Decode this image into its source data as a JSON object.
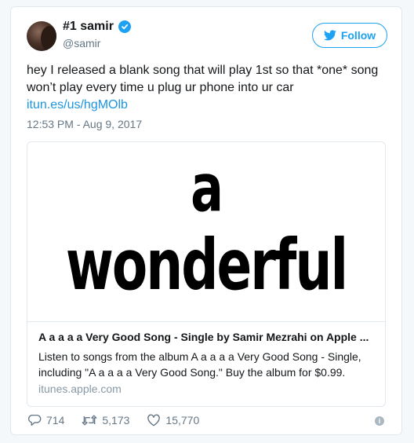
{
  "author": {
    "display_name": "#1 samir",
    "handle": "@samir",
    "verified": true
  },
  "follow_label": "Follow",
  "tweet": {
    "text": "hey I released a blank song that will play 1st so that *one* song won’t play every time u plug ur phone into ur car",
    "link": "itun.es/us/hgMOlb",
    "timestamp": "12:53 PM - Aug 9, 2017"
  },
  "card": {
    "image_words": [
      "a",
      "wonderful"
    ],
    "title": "A a a a a Very Good Song - Single by Samir Mezrahi on Apple ...",
    "description": "Listen to songs from the album A a a a a Very Good Song - Single, including \"A a a a a Very Good Song.\" Buy the album for $0.99.",
    "domain": "itunes.apple.com"
  },
  "stats": {
    "replies": "714",
    "retweets": "5,173",
    "likes": "15,770"
  },
  "colors": {
    "accent": "#1da1f2",
    "link": "#1b95e0",
    "muted": "#657786"
  }
}
